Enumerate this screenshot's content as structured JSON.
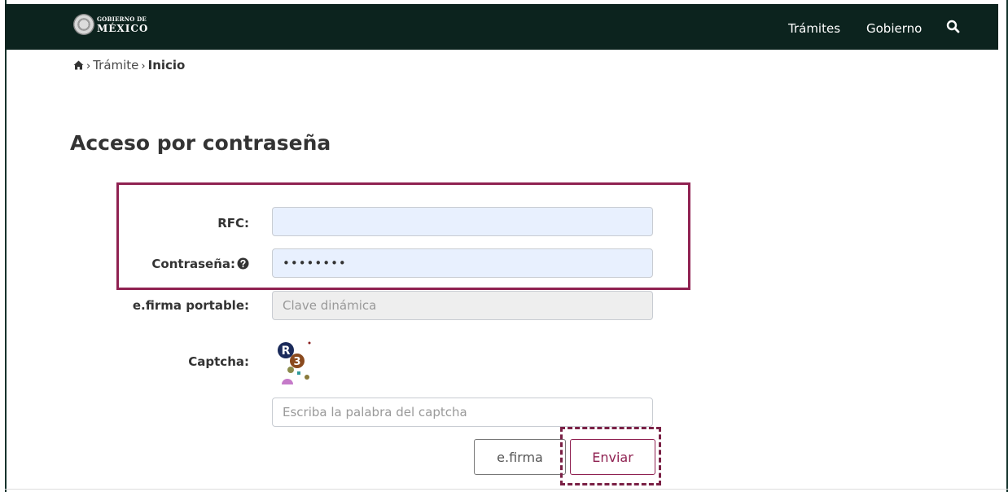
{
  "header": {
    "logo_top": "GOBIERNO DE",
    "logo_main": "MÉXICO",
    "nav": [
      "Trámites",
      "Gobierno"
    ]
  },
  "breadcrumb": {
    "items": [
      "Trámite"
    ],
    "current": "Inicio"
  },
  "page_title": "Acceso por contraseña",
  "form": {
    "rfc_label": "RFC:",
    "rfc_value": "",
    "password_label": "Contraseña:",
    "password_value": "••••••••",
    "efirma_portable_label": "e.firma portable:",
    "efirma_portable_placeholder": "Clave dinámica",
    "captcha_label": "Captcha:",
    "captcha_placeholder": "Escriba la palabra del captcha"
  },
  "buttons": {
    "efirma": "e.firma",
    "enviar": "Enviar"
  },
  "colors": {
    "header_bg": "#0c231e",
    "accent": "#8f2151",
    "autofill_bg": "#e8f0fe"
  }
}
